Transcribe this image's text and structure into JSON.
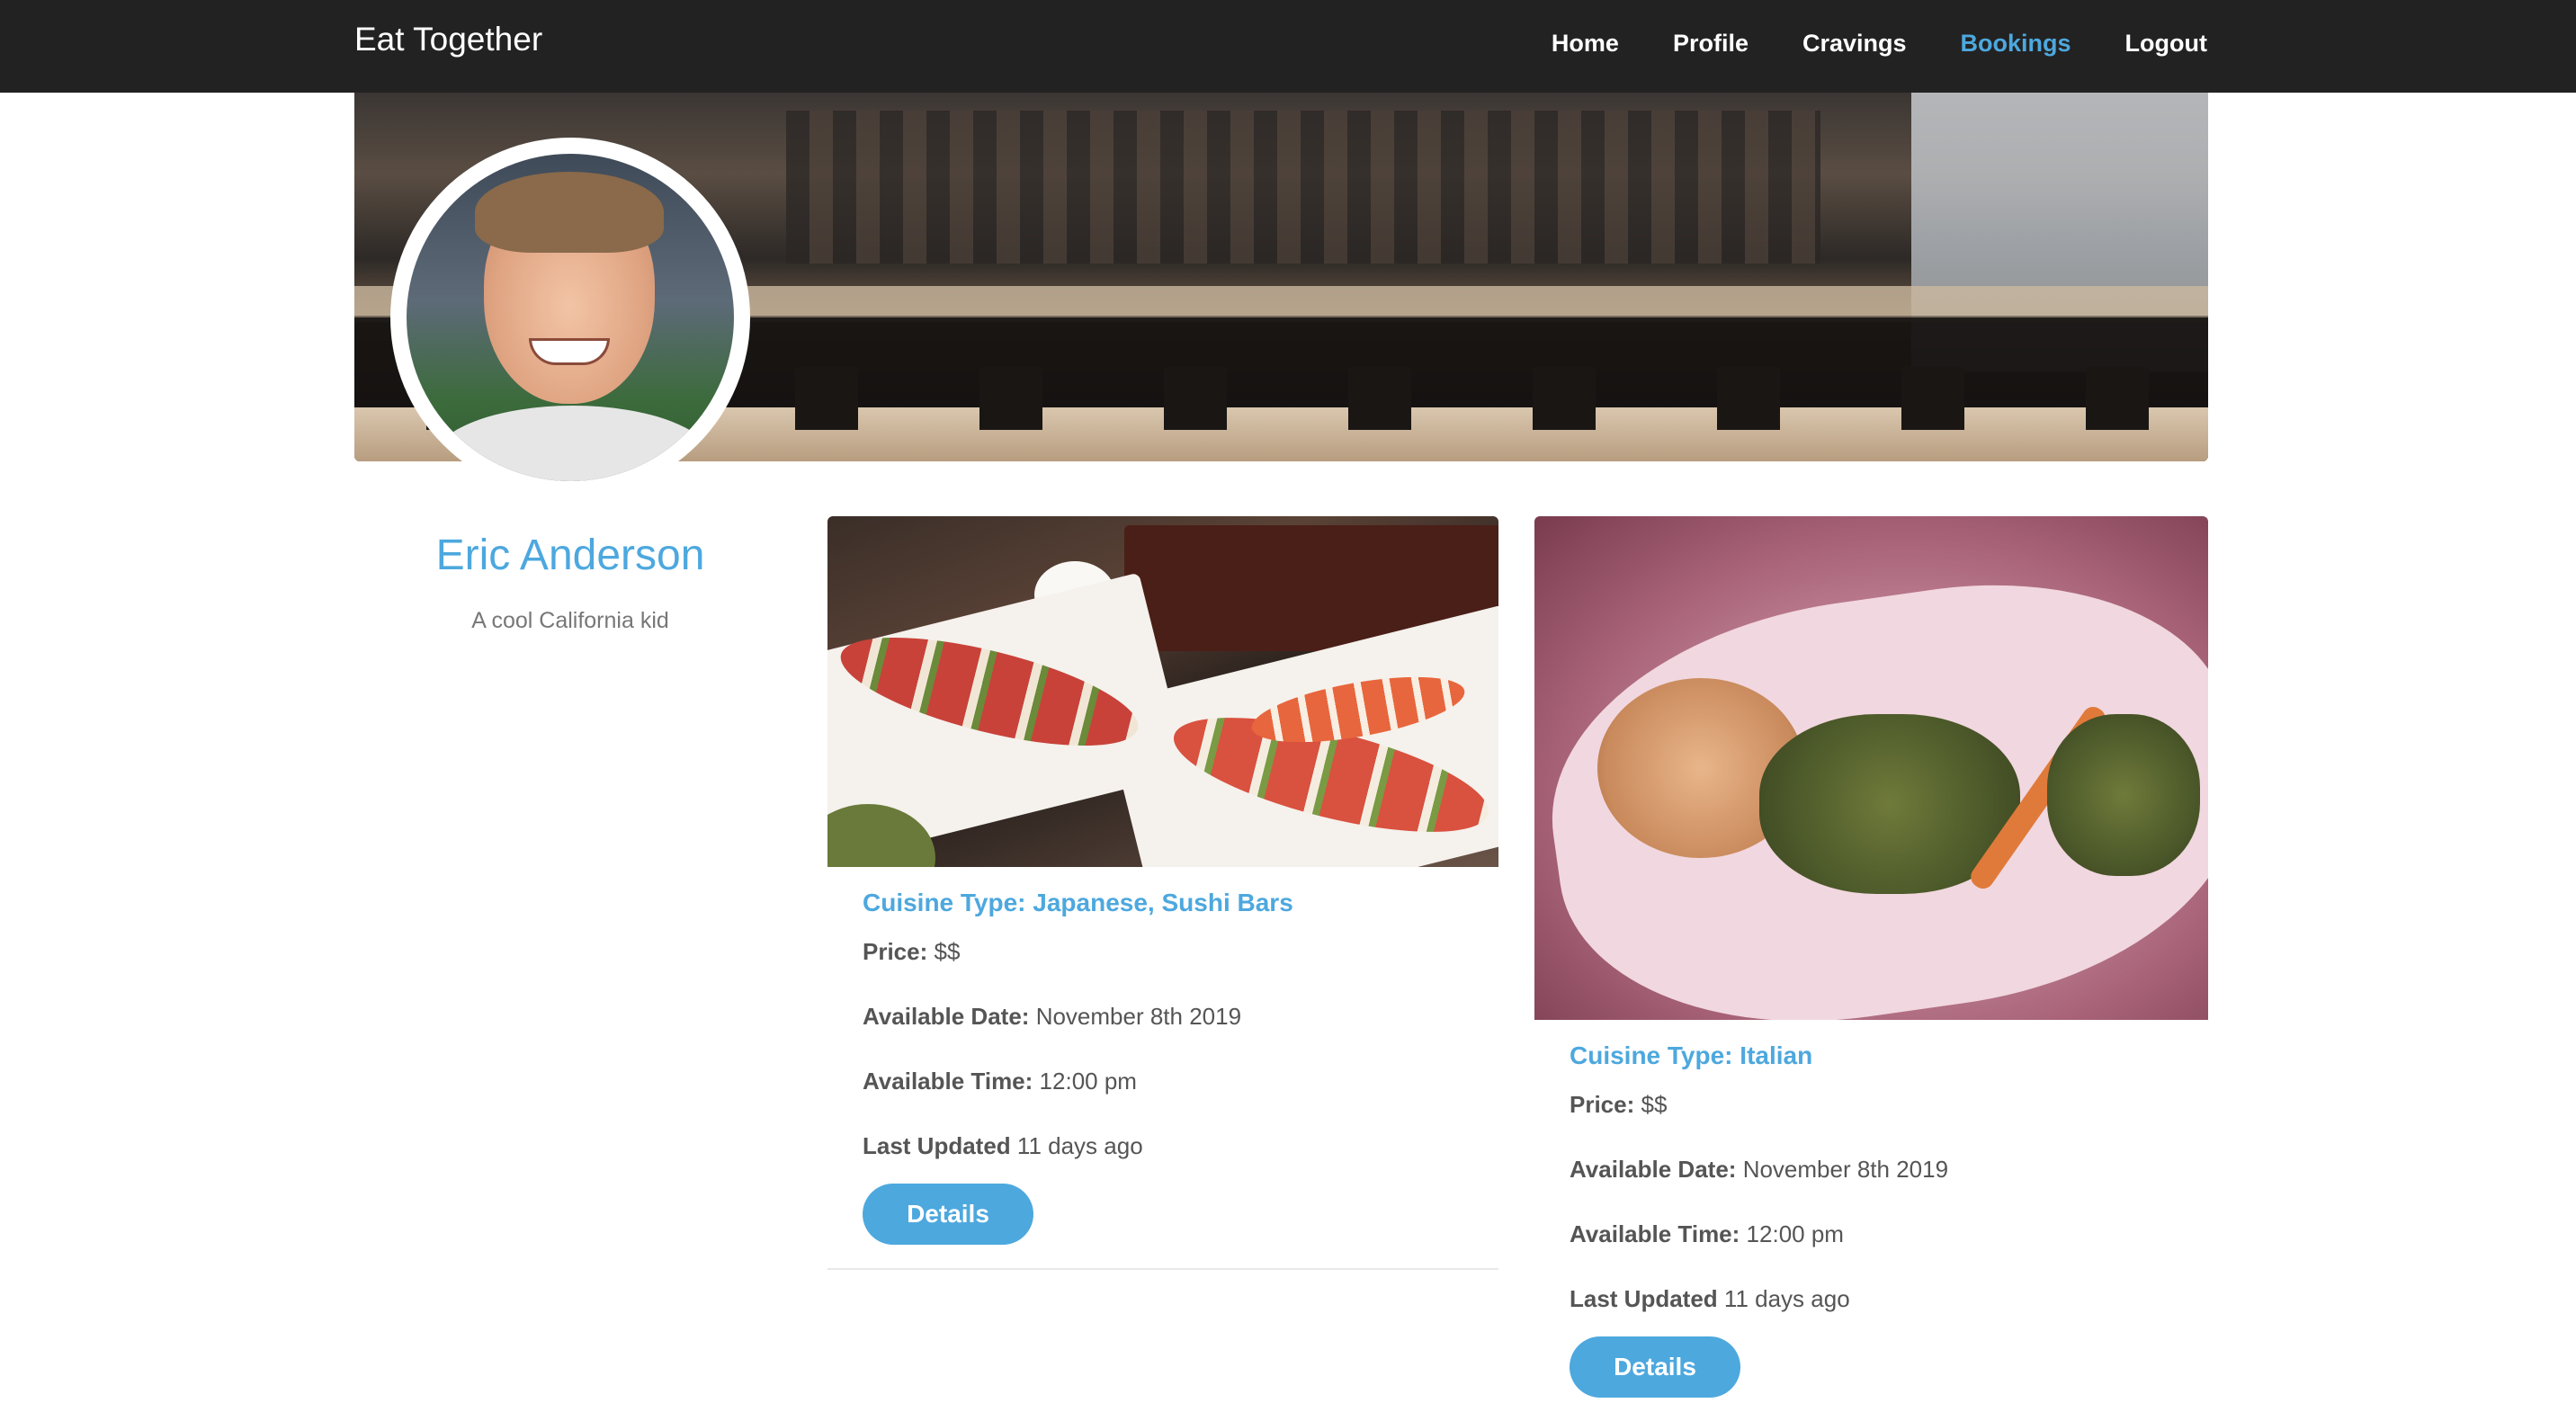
{
  "navbar": {
    "brand": "Eat Together",
    "links": [
      {
        "label": "Home"
      },
      {
        "label": "Profile"
      },
      {
        "label": "Cravings"
      },
      {
        "label": "Bookings",
        "active": true
      },
      {
        "label": "Logout"
      }
    ],
    "active_color": "#4da8de"
  },
  "profile": {
    "name": "Eric Anderson",
    "bio": "A cool California kid"
  },
  "bookings": [
    {
      "cuisine": "Cuisine Type: Japanese, Sushi Bars",
      "price_label": "Price:",
      "price": "$$",
      "date_label": "Available Date:",
      "date": "November 8th 2019",
      "time_label": "Available Time:",
      "time": "12:00 pm",
      "updated_label": "Last Updated",
      "updated": "11 days ago",
      "button": "Details"
    },
    {
      "cuisine": "Cuisine Type: Italian",
      "price_label": "Price:",
      "price": "$$",
      "date_label": "Available Date:",
      "date": "November 8th 2019",
      "time_label": "Available Time:",
      "time": "12:00 pm",
      "updated_label": "Last Updated",
      "updated": "11 days ago",
      "button": "Details"
    }
  ],
  "colors": {
    "accent": "#4da8de",
    "navbar_bg": "#222222",
    "text": "#555555"
  }
}
